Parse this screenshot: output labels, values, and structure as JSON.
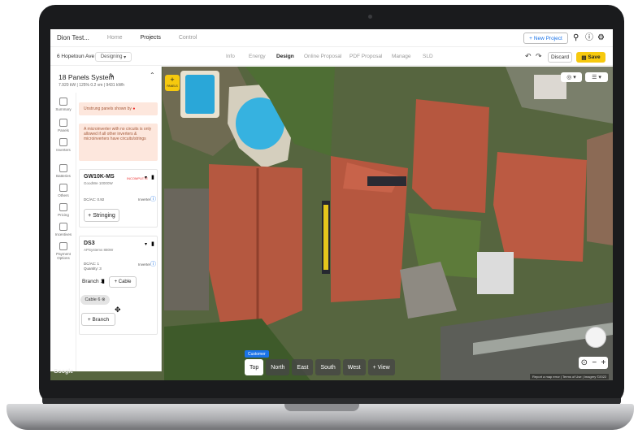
{
  "topnav": {
    "brand": "Dion Test...",
    "items": [
      "Home",
      "Projects",
      "Control"
    ],
    "new_project": "+ New Project"
  },
  "subnav": {
    "address": "6 Hopetoun Ave",
    "mode": "Designing",
    "tabs": [
      "Info",
      "Energy",
      "Design",
      "Online Proposal",
      "PDF Proposal",
      "Manage",
      "SLD"
    ],
    "active_tab": "Design",
    "discard": "Discard",
    "save": "Save"
  },
  "system": {
    "title": "18 Panels System",
    "stats": "7.920 kW  |  125% 0.2 vm  |  9431 kWh"
  },
  "sidebar": [
    "Summary",
    "Panels",
    "Inverters",
    "Batteries",
    "Others",
    "Pricing",
    "Incentives",
    "Payment Options"
  ],
  "warnings": {
    "unstrung": "Unstrung panels shown by",
    "microinverter": "A microinverter with no circuits is only allowed if all other inverters & microinverters have circuits/strings"
  },
  "inverter1": {
    "model": "GW10K-MS",
    "maker": "GoodWe 10000W",
    "tag": "INCOMPLETE",
    "dcac": "DC/AC: 0.92",
    "info": "Inverter",
    "stringing": "+ Stringing"
  },
  "inverter2": {
    "model": "DS3",
    "maker": "APSystems 880W",
    "dcac": "DC/AC: 1",
    "quantity": "Quantity: 3",
    "info": "Inverter",
    "branch": "Branch 1",
    "cable": "+ Cable",
    "chip": "Cable 6",
    "add_branch": "+ Branch"
  },
  "map": {
    "add_label": "PANELS",
    "customer": "Customer",
    "views": [
      "Top",
      "North",
      "East",
      "South",
      "West",
      "+ View"
    ],
    "google": "Google",
    "attribution": "Report a map error | Terms of Use | Imagery ©2022"
  }
}
